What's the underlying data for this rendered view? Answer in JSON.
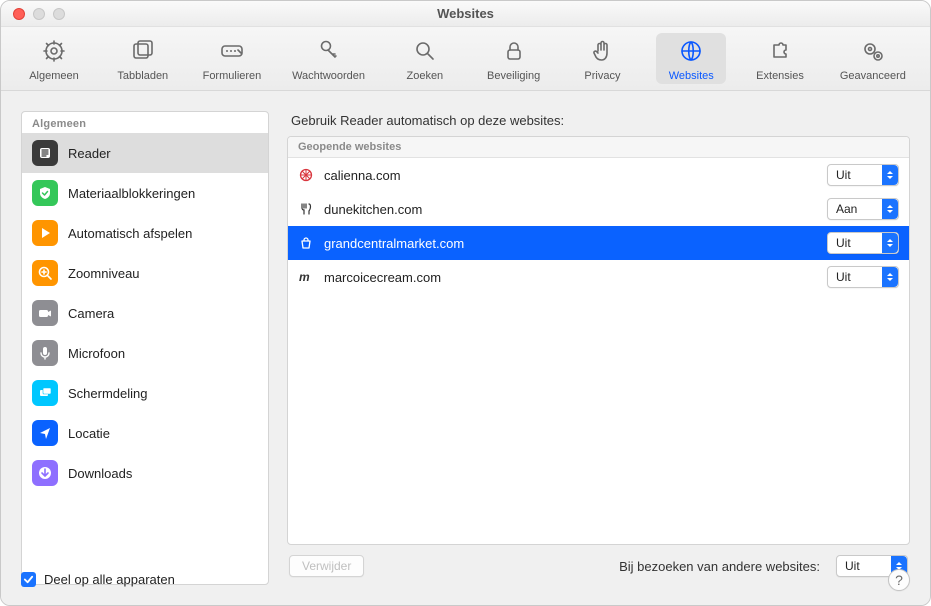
{
  "window": {
    "title": "Websites"
  },
  "toolbar": [
    {
      "id": "general",
      "label": "Algemeen",
      "icon": "gear",
      "selected": false
    },
    {
      "id": "tabs",
      "label": "Tabbladen",
      "icon": "tabs",
      "selected": false
    },
    {
      "id": "autofill",
      "label": "Formulieren",
      "icon": "autofill",
      "selected": false
    },
    {
      "id": "passwords",
      "label": "Wachtwoorden",
      "icon": "key",
      "selected": false
    },
    {
      "id": "search",
      "label": "Zoeken",
      "icon": "search",
      "selected": false
    },
    {
      "id": "security",
      "label": "Beveiliging",
      "icon": "lock",
      "selected": false
    },
    {
      "id": "privacy",
      "label": "Privacy",
      "icon": "hand",
      "selected": false
    },
    {
      "id": "websites",
      "label": "Websites",
      "icon": "globe",
      "selected": true
    },
    {
      "id": "extensions",
      "label": "Extensies",
      "icon": "puzzle",
      "selected": false
    },
    {
      "id": "advanced",
      "label": "Geavanceerd",
      "icon": "gears",
      "selected": false
    }
  ],
  "sidebar": {
    "header": "Algemeen",
    "items": [
      {
        "id": "reader",
        "label": "Reader",
        "icon": "reader",
        "color": "#3a3a3a",
        "selected": true
      },
      {
        "id": "blockers",
        "label": "Materiaalblokkeringen",
        "icon": "shield",
        "color": "#34c759",
        "selected": false
      },
      {
        "id": "autoplay",
        "label": "Automatisch afspelen",
        "icon": "play",
        "color": "#ff9500",
        "selected": false
      },
      {
        "id": "zoom",
        "label": "Zoomniveau",
        "icon": "zoom",
        "color": "#ff9500",
        "selected": false
      },
      {
        "id": "camera",
        "label": "Camera",
        "icon": "camera",
        "color": "#8e8e93",
        "selected": false
      },
      {
        "id": "microphone",
        "label": "Microfoon",
        "icon": "mic",
        "color": "#8e8e93",
        "selected": false
      },
      {
        "id": "screenshare",
        "label": "Schermdeling",
        "icon": "screen",
        "color": "#00c7ff",
        "selected": false
      },
      {
        "id": "location",
        "label": "Locatie",
        "icon": "location",
        "color": "#0a62ff",
        "selected": false
      },
      {
        "id": "downloads",
        "label": "Downloads",
        "icon": "download",
        "color": "#8e6fff",
        "selected": false
      }
    ]
  },
  "pane": {
    "title": "Gebruik Reader automatisch op deze websites:",
    "section_header": "Geopende websites",
    "websites": [
      {
        "domain": "calienna.com",
        "value": "Uit",
        "selected": false,
        "fav": "wheel"
      },
      {
        "domain": "dunekitchen.com",
        "value": "Aan",
        "selected": false,
        "fav": "fork"
      },
      {
        "domain": "grandcentralmarket.com",
        "value": "Uit",
        "selected": true,
        "fav": "bag"
      },
      {
        "domain": "marcoicecream.com",
        "value": "Uit",
        "selected": false,
        "fav": "script"
      }
    ],
    "remove_button": "Verwijder",
    "other_label": "Bij bezoeken van andere websites:",
    "other_value": "Uit"
  },
  "bottom": {
    "share_label": "Deel op alle apparaten",
    "share_checked": true
  }
}
